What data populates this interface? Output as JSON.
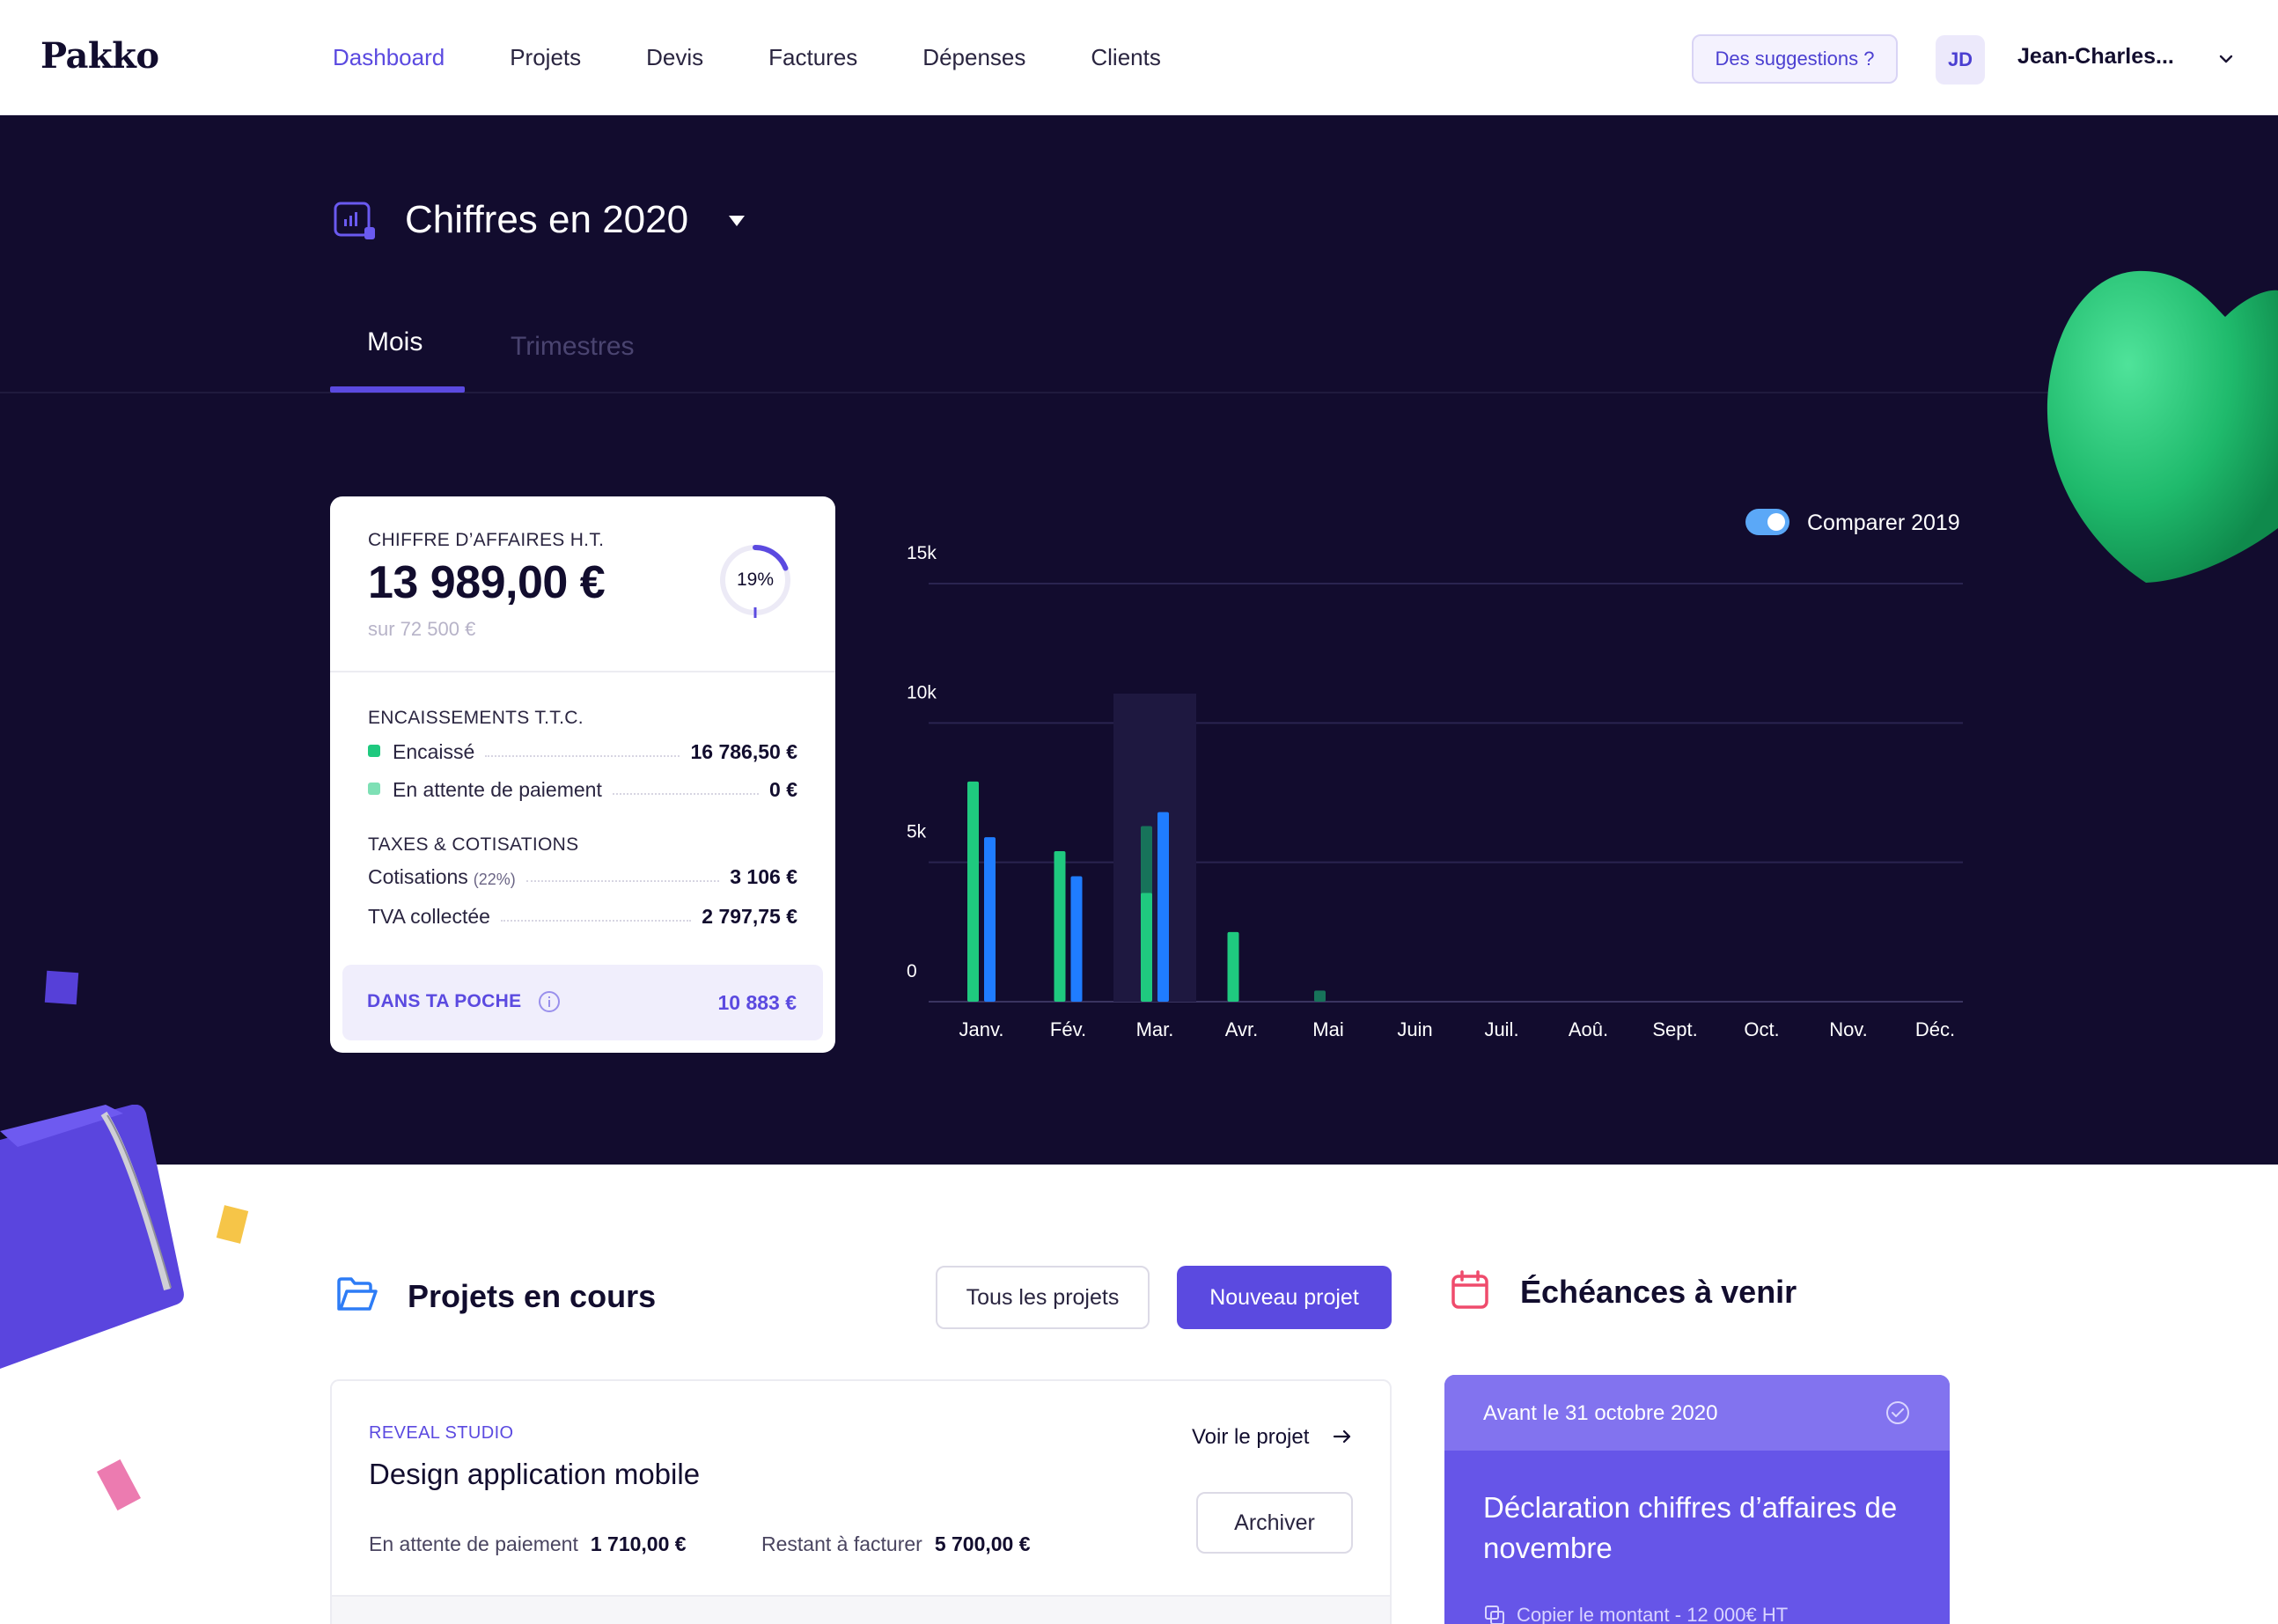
{
  "app": {
    "logo": "Pakko"
  },
  "nav": {
    "items": [
      {
        "label": "Dashboard",
        "active": true
      },
      {
        "label": "Projets",
        "active": false
      },
      {
        "label": "Devis",
        "active": false
      },
      {
        "label": "Factures",
        "active": false
      },
      {
        "label": "Dépenses",
        "active": false
      },
      {
        "label": "Clients",
        "active": false
      }
    ],
    "suggestions": "Des suggestions ?",
    "user_initials": "JD",
    "user_name": "Jean-Charles..."
  },
  "hero": {
    "title": "Chiffres en 2020",
    "tabs": [
      {
        "label": "Mois",
        "active": true
      },
      {
        "label": "Trimestres",
        "active": false
      }
    ]
  },
  "summary": {
    "ca_label": "CHIFFRE D’AFFAIRES H.T.",
    "ca_amount": "13 989,00 €",
    "ca_target": "sur 72 500 €",
    "progress_label": "19%",
    "progress": 0.19,
    "encaissements_label": "ENCAISSEMENTS T.T.C.",
    "encaisse_label": "Encaissé",
    "encaisse_value": "16 786,50 €",
    "attente_label": "En attente de paiement",
    "attente_value": "0 €",
    "taxes_label": "TAXES & COTISATIONS",
    "cotisations_label": "Cotisations",
    "cotisations_rate": "(22%)",
    "cotisations_value": "3 106 €",
    "tva_label": "TVA collectée",
    "tva_value": "2 797,75 €",
    "pocket_label": "DANS TA POCHE",
    "pocket_value": "10 883 €"
  },
  "compare": {
    "label": "Comparer 2019",
    "on": true
  },
  "colors": {
    "accent": "#5b4ae0",
    "green": "#1fc97f",
    "green_light": "#7ee0b5",
    "blue": "#1f7cff",
    "dark_green": "#17735a",
    "hero_bg": "#120c2e"
  },
  "chart_data": {
    "type": "bar",
    "categories": [
      "Janv.",
      "Fév.",
      "Mar.",
      "Avr.",
      "Mai",
      "Juin",
      "Juil.",
      "Aoû.",
      "Sept.",
      "Oct.",
      "Nov.",
      "Déc."
    ],
    "series": [
      {
        "values": [
          7900,
          5400,
          3900,
          2500,
          400,
          0,
          0,
          0,
          0,
          0,
          0,
          0
        ]
      },
      {
        "values": [
          5900,
          4500,
          6800,
          0,
          0,
          0,
          0,
          0,
          0,
          0,
          0,
          0
        ]
      }
    ],
    "overlay_march": 6300,
    "highlight_category": "Mar.",
    "y_ticks": [
      "15k",
      "10k",
      "5k",
      "0"
    ],
    "ylim": [
      0,
      15000
    ],
    "grid": true
  },
  "projects": {
    "title": "Projets en cours",
    "all_button": "Tous les projets",
    "new_button": "Nouveau projet",
    "items": [
      {
        "client": "REVEAL STUDIO",
        "name": "Design application mobile",
        "pending_label": "En attente de paiement",
        "pending_value": "1 710,00 €",
        "remaining_label": "Restant à facturer",
        "remaining_value": "5 700,00 €",
        "link": "Voir le projet",
        "archive": "Archiver"
      }
    ]
  },
  "deadlines": {
    "title": "Échéances à venir",
    "items": [
      {
        "date": "Avant le 31 octobre 2020",
        "title": "Déclaration chiffres d’affaires de novembre",
        "copy": "Copier le montant - 12 000€ HT"
      }
    ]
  }
}
